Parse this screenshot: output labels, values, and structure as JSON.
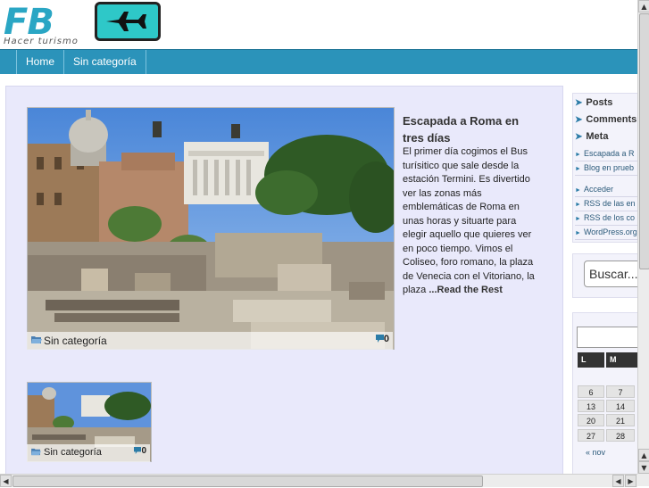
{
  "header": {
    "logo_text": "FB",
    "logo_tagline": "Hacer turismo",
    "plane_icon": "airplane-icon"
  },
  "nav": {
    "items": [
      "Home",
      "Sin categoría"
    ]
  },
  "featured_post": {
    "title": "Escapada a Roma en tres días",
    "excerpt": "El primer día cogimos el Bus turísitico que sale desde la estación Termini. Es divertido ver las zonas más emblemáticas de Roma en unas horas y situarte para elegir aquello que quieres ver en poco tiempo. Vimos el Coliseo, foro romano, la plaza de Venecia con el Vitoriano, la plaza ",
    "read_more": "...Read the Rest",
    "category": "Sin categoría",
    "comment_count": "0"
  },
  "second_post": {
    "category": "Sin categoría",
    "comment_count": "0"
  },
  "sidebar": {
    "headings": [
      "Posts",
      "Comments",
      "Meta"
    ],
    "posts_links": [
      "Escapada a R",
      "Blog en prueb"
    ],
    "meta_links": [
      "Acceder",
      "RSS de las en",
      "RSS de los co",
      "WordPress.org"
    ],
    "search_placeholder": "Buscar...",
    "calendar": {
      "day_headers": [
        "L",
        "M"
      ],
      "rows": [
        [
          "6",
          "7"
        ],
        [
          "13",
          "14"
        ],
        [
          "20",
          "21"
        ],
        [
          "27",
          "28"
        ]
      ],
      "prev_link": "« nov"
    }
  },
  "colors": {
    "nav_bg": "#2b93ba",
    "accent": "#2aa6c4",
    "content_bg": "#e9e9fb"
  }
}
